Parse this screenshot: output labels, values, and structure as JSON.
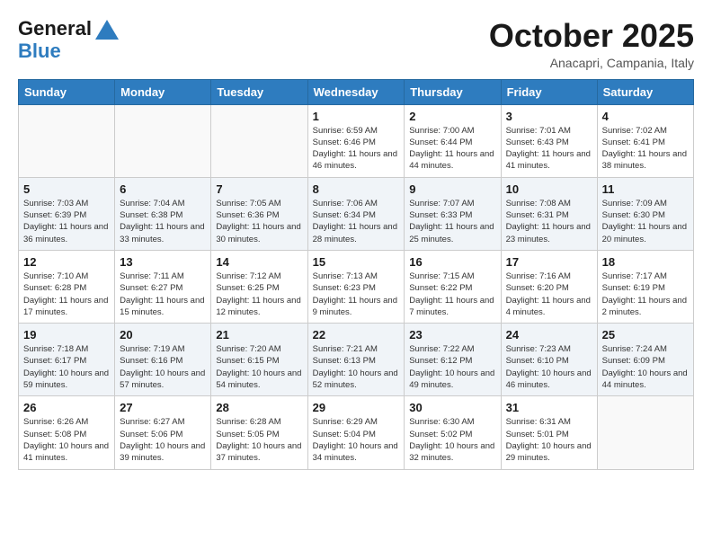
{
  "header": {
    "logo_line1": "General",
    "logo_line2": "Blue",
    "month_title": "October 2025",
    "subtitle": "Anacapri, Campania, Italy"
  },
  "weekdays": [
    "Sunday",
    "Monday",
    "Tuesday",
    "Wednesday",
    "Thursday",
    "Friday",
    "Saturday"
  ],
  "rows": [
    [
      {
        "day": "",
        "info": ""
      },
      {
        "day": "",
        "info": ""
      },
      {
        "day": "",
        "info": ""
      },
      {
        "day": "1",
        "info": "Sunrise: 6:59 AM\nSunset: 6:46 PM\nDaylight: 11 hours and 46 minutes."
      },
      {
        "day": "2",
        "info": "Sunrise: 7:00 AM\nSunset: 6:44 PM\nDaylight: 11 hours and 44 minutes."
      },
      {
        "day": "3",
        "info": "Sunrise: 7:01 AM\nSunset: 6:43 PM\nDaylight: 11 hours and 41 minutes."
      },
      {
        "day": "4",
        "info": "Sunrise: 7:02 AM\nSunset: 6:41 PM\nDaylight: 11 hours and 38 minutes."
      }
    ],
    [
      {
        "day": "5",
        "info": "Sunrise: 7:03 AM\nSunset: 6:39 PM\nDaylight: 11 hours and 36 minutes."
      },
      {
        "day": "6",
        "info": "Sunrise: 7:04 AM\nSunset: 6:38 PM\nDaylight: 11 hours and 33 minutes."
      },
      {
        "day": "7",
        "info": "Sunrise: 7:05 AM\nSunset: 6:36 PM\nDaylight: 11 hours and 30 minutes."
      },
      {
        "day": "8",
        "info": "Sunrise: 7:06 AM\nSunset: 6:34 PM\nDaylight: 11 hours and 28 minutes."
      },
      {
        "day": "9",
        "info": "Sunrise: 7:07 AM\nSunset: 6:33 PM\nDaylight: 11 hours and 25 minutes."
      },
      {
        "day": "10",
        "info": "Sunrise: 7:08 AM\nSunset: 6:31 PM\nDaylight: 11 hours and 23 minutes."
      },
      {
        "day": "11",
        "info": "Sunrise: 7:09 AM\nSunset: 6:30 PM\nDaylight: 11 hours and 20 minutes."
      }
    ],
    [
      {
        "day": "12",
        "info": "Sunrise: 7:10 AM\nSunset: 6:28 PM\nDaylight: 11 hours and 17 minutes."
      },
      {
        "day": "13",
        "info": "Sunrise: 7:11 AM\nSunset: 6:27 PM\nDaylight: 11 hours and 15 minutes."
      },
      {
        "day": "14",
        "info": "Sunrise: 7:12 AM\nSunset: 6:25 PM\nDaylight: 11 hours and 12 minutes."
      },
      {
        "day": "15",
        "info": "Sunrise: 7:13 AM\nSunset: 6:23 PM\nDaylight: 11 hours and 9 minutes."
      },
      {
        "day": "16",
        "info": "Sunrise: 7:15 AM\nSunset: 6:22 PM\nDaylight: 11 hours and 7 minutes."
      },
      {
        "day": "17",
        "info": "Sunrise: 7:16 AM\nSunset: 6:20 PM\nDaylight: 11 hours and 4 minutes."
      },
      {
        "day": "18",
        "info": "Sunrise: 7:17 AM\nSunset: 6:19 PM\nDaylight: 11 hours and 2 minutes."
      }
    ],
    [
      {
        "day": "19",
        "info": "Sunrise: 7:18 AM\nSunset: 6:17 PM\nDaylight: 10 hours and 59 minutes."
      },
      {
        "day": "20",
        "info": "Sunrise: 7:19 AM\nSunset: 6:16 PM\nDaylight: 10 hours and 57 minutes."
      },
      {
        "day": "21",
        "info": "Sunrise: 7:20 AM\nSunset: 6:15 PM\nDaylight: 10 hours and 54 minutes."
      },
      {
        "day": "22",
        "info": "Sunrise: 7:21 AM\nSunset: 6:13 PM\nDaylight: 10 hours and 52 minutes."
      },
      {
        "day": "23",
        "info": "Sunrise: 7:22 AM\nSunset: 6:12 PM\nDaylight: 10 hours and 49 minutes."
      },
      {
        "day": "24",
        "info": "Sunrise: 7:23 AM\nSunset: 6:10 PM\nDaylight: 10 hours and 46 minutes."
      },
      {
        "day": "25",
        "info": "Sunrise: 7:24 AM\nSunset: 6:09 PM\nDaylight: 10 hours and 44 minutes."
      }
    ],
    [
      {
        "day": "26",
        "info": "Sunrise: 6:26 AM\nSunset: 5:08 PM\nDaylight: 10 hours and 41 minutes."
      },
      {
        "day": "27",
        "info": "Sunrise: 6:27 AM\nSunset: 5:06 PM\nDaylight: 10 hours and 39 minutes."
      },
      {
        "day": "28",
        "info": "Sunrise: 6:28 AM\nSunset: 5:05 PM\nDaylight: 10 hours and 37 minutes."
      },
      {
        "day": "29",
        "info": "Sunrise: 6:29 AM\nSunset: 5:04 PM\nDaylight: 10 hours and 34 minutes."
      },
      {
        "day": "30",
        "info": "Sunrise: 6:30 AM\nSunset: 5:02 PM\nDaylight: 10 hours and 32 minutes."
      },
      {
        "day": "31",
        "info": "Sunrise: 6:31 AM\nSunset: 5:01 PM\nDaylight: 10 hours and 29 minutes."
      },
      {
        "day": "",
        "info": ""
      }
    ]
  ]
}
